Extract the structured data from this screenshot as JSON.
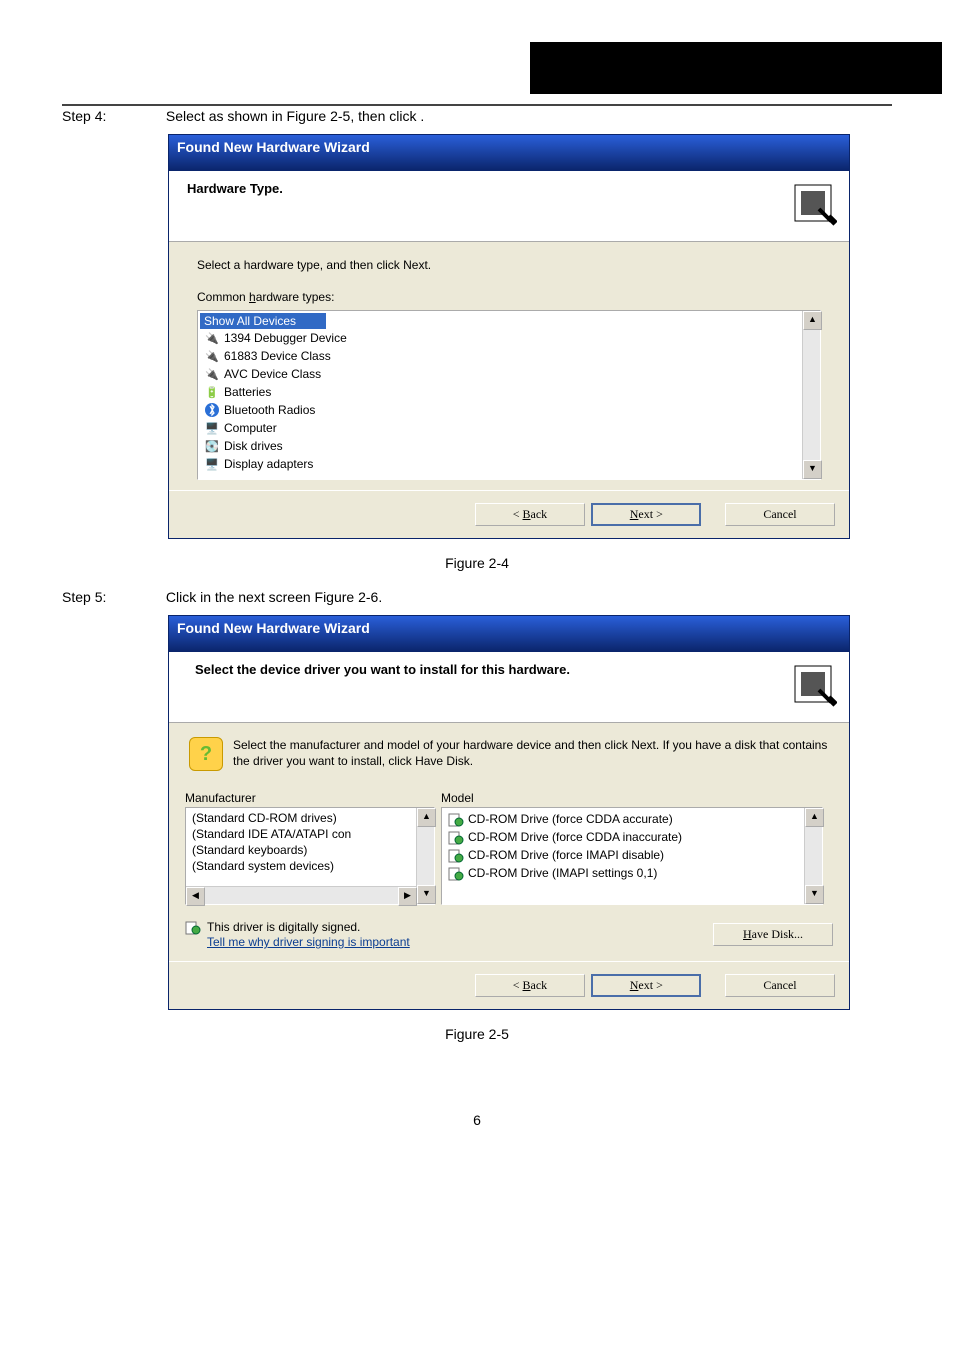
{
  "header": {
    "black_area": ""
  },
  "step4": {
    "label": "Step 4:",
    "pre": "Select ",
    "mid": " as shown in Figure   2-5, then click ",
    "post": " ."
  },
  "wiz1": {
    "title": "Found New Hardware Wizard",
    "hdr": "Hardware Type.",
    "body_instr": "Select a hardware type, and then click Next.",
    "list_label_pre": "Common ",
    "list_label_u": "h",
    "list_label_post": "ardware types:",
    "items": [
      "Show All Devices",
      "1394 Debugger Device",
      "61883 Device Class",
      "AVC Device Class",
      "Batteries",
      "Bluetooth Radios",
      "Computer",
      "Disk drives",
      "Display adapters"
    ],
    "back_pre": "< ",
    "back_u": "B",
    "back_post": "ack",
    "next_u": "N",
    "next_post": "ext >",
    "cancel": "Cancel"
  },
  "fig1_caption": "Figure 2-4",
  "step5": {
    "label": "Step 5:",
    "pre": "Click ",
    "mid": " in the next screen Figure   2-6."
  },
  "wiz2": {
    "title": "Found New Hardware Wizard",
    "hdr": "Select the device driver you want to install for this hardware.",
    "info": "Select the manufacturer and model of your hardware device and then click Next. If you have a disk that contains the driver you want to install, click Have Disk.",
    "mfr_label": "Manufacturer",
    "model_label": "Model",
    "mfrs": [
      "(Standard CD-ROM drives)",
      "(Standard IDE ATA/ATAPI con",
      "(Standard keyboards)",
      "(Standard system devices)"
    ],
    "models": [
      "CD-ROM Drive (force CDDA accurate)",
      "CD-ROM Drive (force CDDA inaccurate)",
      "CD-ROM Drive (force IMAPI disable)",
      "CD-ROM Drive (IMAPI settings 0,1)"
    ],
    "signed_text": "This driver is digitally signed.",
    "signed_link_pre": "T",
    "signed_link_post": "ell me why driver signing is important",
    "have_disk_u": "H",
    "have_disk_post": "ave Disk...",
    "back_pre": "< ",
    "back_u": "B",
    "back_post": "ack",
    "next_u": "N",
    "next_post": "ext >",
    "cancel": "Cancel"
  },
  "fig2_caption": "Figure 2-5",
  "page_num": "6"
}
